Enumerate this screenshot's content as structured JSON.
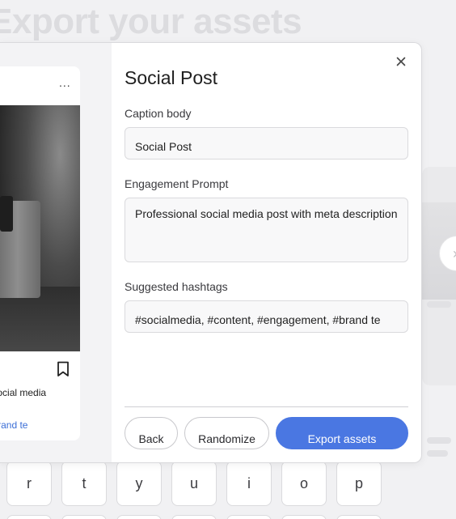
{
  "background": {
    "heading": "Export your assets",
    "keyboard_keys": [
      "r",
      "t",
      "y",
      "u",
      "i",
      "o",
      "p"
    ]
  },
  "modal": {
    "title": "Social Post",
    "preview": {
      "menu_label": "...",
      "caption": "Professional social media",
      "tags": "#content, #engagement, #brand te"
    },
    "fields": {
      "caption_label": "Caption body",
      "caption_value": "Social Post",
      "engagement_label": "Engagement Prompt",
      "engagement_value": "Professional social media post with meta description",
      "hashtags_label": "Suggested hashtags",
      "hashtags_value": "#socialmedia, #content, #engagement, #brand te"
    },
    "buttons": {
      "back": "Back",
      "randomize": "Randomize",
      "export": "Export assets"
    }
  },
  "colors": {
    "accent": "#4a77e2",
    "link": "#3b6ed6"
  }
}
